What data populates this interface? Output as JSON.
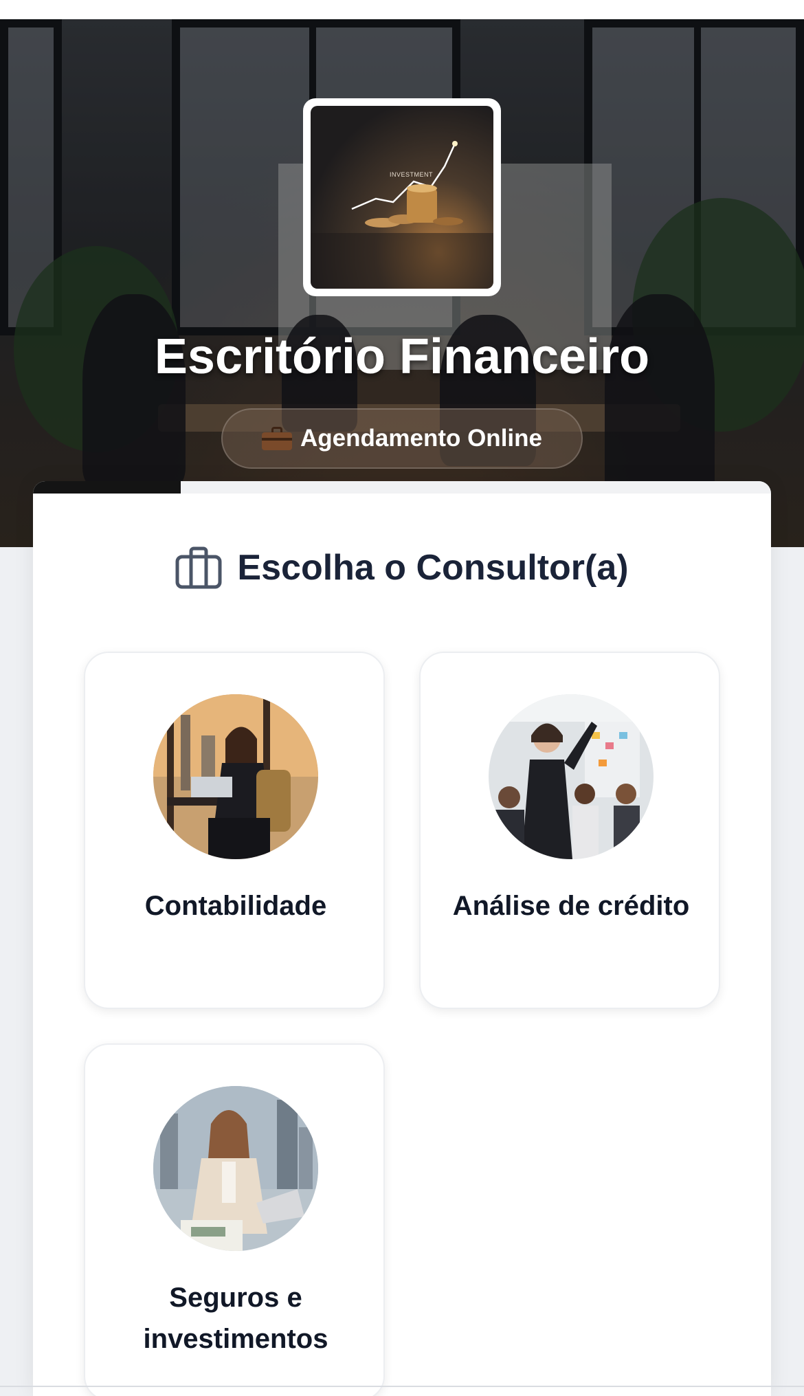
{
  "hero": {
    "logo_caption": "INVESTMENT",
    "title": "Escritório Financeiro",
    "badge_label": "Agendamento Online"
  },
  "booking": {
    "progress_fraction": 0.2,
    "section_title": "Escolha o Consultor(a)",
    "consultants": [
      {
        "name": "Contabilidade"
      },
      {
        "name": "Análise de crédito"
      },
      {
        "name": "Seguros e investimentos"
      }
    ]
  },
  "colors": {
    "title_text": "#1a2338",
    "progress": "#141414",
    "card_bg": "#ffffff"
  }
}
